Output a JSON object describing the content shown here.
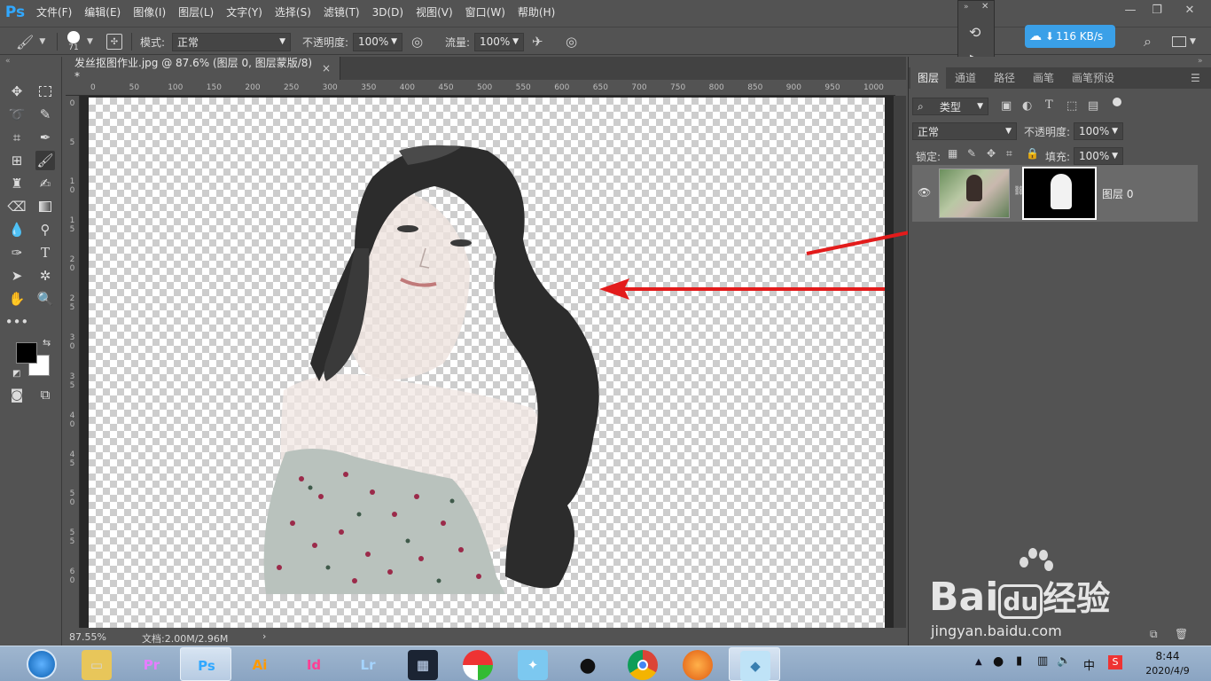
{
  "app": {
    "logo": "Ps"
  },
  "menu": [
    "文件(F)",
    "编辑(E)",
    "图像(I)",
    "图层(L)",
    "文字(Y)",
    "选择(S)",
    "滤镜(T)",
    "3D(D)",
    "视图(V)",
    "窗口(W)",
    "帮助(H)"
  ],
  "options": {
    "brush_size": "71",
    "mode_label": "模式:",
    "mode_value": "正常",
    "opacity_label": "不透明度:",
    "opacity_value": "100%",
    "flow_label": "流量:",
    "flow_value": "100%"
  },
  "net": {
    "speed": "116 KB/s"
  },
  "document": {
    "tab_title": "发丝抠图作业.jpg @ 87.6% (图层 0, 图层蒙版/8) *",
    "close": "×",
    "ruler_top": [
      "0",
      "50",
      "100",
      "150",
      "200",
      "250",
      "300",
      "350",
      "400",
      "450",
      "500",
      "550",
      "600",
      "650",
      "700",
      "750",
      "800",
      "850",
      "900",
      "950",
      "1000"
    ],
    "ruler_left": [
      "0",
      "5",
      "1\n0",
      "1\n5",
      "2\n0",
      "2\n5",
      "3\n0",
      "3\n5",
      "4\n0",
      "4\n5",
      "5\n0",
      "5\n5",
      "6\n0"
    ]
  },
  "status": {
    "zoom": "87.55%",
    "doc_info": "文档:2.00M/2.96M",
    "arrow": "›"
  },
  "layers_panel": {
    "tabs": [
      "图层",
      "通道",
      "路径",
      "画笔",
      "画笔预设"
    ],
    "filter_kind": "类型",
    "blend_mode": "正常",
    "opacity_label": "不透明度:",
    "opacity_value": "100%",
    "lock_label": "锁定:",
    "fill_label": "填充:",
    "fill_value": "100%",
    "layer_name": "图层 0"
  },
  "watermark": {
    "brand": "Bai",
    "brand2": "du",
    "suffix": "经验",
    "url": "jingyan.baidu.com"
  },
  "taskbar": {
    "apps": [
      {
        "label": "Pr",
        "bg": "#2a0a3a",
        "fg": "#e77cff"
      },
      {
        "label": "Ps",
        "bg": "#061e36",
        "fg": "#31a8ff"
      },
      {
        "label": "Ai",
        "bg": "#3a1a00",
        "fg": "#ff9a00"
      },
      {
        "label": "Id",
        "bg": "#3d0a22",
        "fg": "#ff3f94"
      },
      {
        "label": "Lr",
        "bg": "#0d2438",
        "fg": "#a5d4ff"
      }
    ],
    "time": "8:44",
    "date": "2020/4/9",
    "ime": "中"
  },
  "colors": {
    "accent": "#31a8ff",
    "arrow": "#e31b1b"
  }
}
